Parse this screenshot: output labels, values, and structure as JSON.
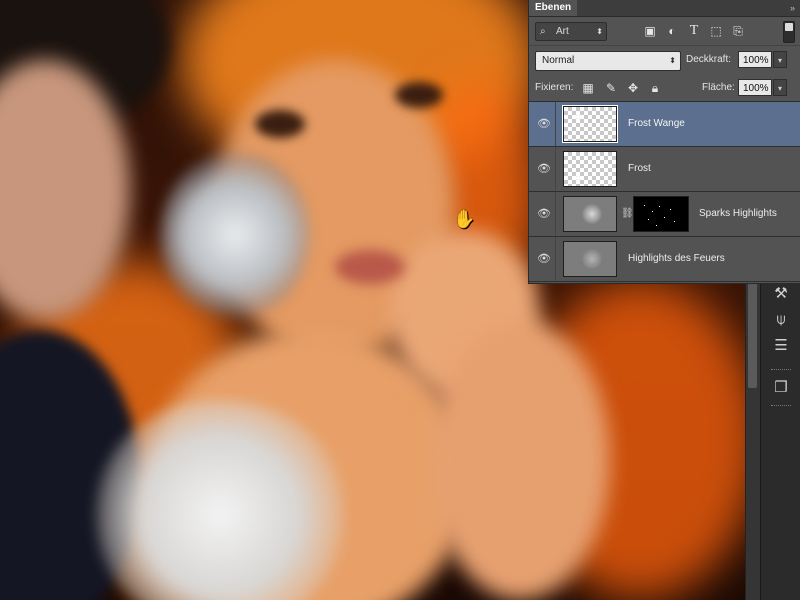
{
  "panel": {
    "tab_label": "Ebenen",
    "collapse_icon": "double-chevron-icon",
    "filter": {
      "icon": "search-icon",
      "value": "Art",
      "options_visible": [
        "Art"
      ]
    },
    "filter_icons": [
      "image-filter-icon",
      "adjustment-filter-icon",
      "type-filter-icon",
      "shape-filter-icon",
      "smart-object-filter-icon"
    ],
    "blend_mode": "Normal",
    "opacity_label": "Deckkraft:",
    "opacity_value": "100%",
    "lock_label": "Fixieren:",
    "lock_icons": [
      "lock-transparency-icon",
      "lock-pixels-icon",
      "lock-position-icon",
      "lock-all-icon"
    ],
    "fill_label": "Fläche:",
    "fill_value": "100%"
  },
  "layers": [
    {
      "name": "Frost Wange",
      "selected": true,
      "visible": true,
      "has_mask": false
    },
    {
      "name": "Frost",
      "selected": false,
      "visible": true,
      "has_mask": false
    },
    {
      "name": "Sparks Highlights",
      "selected": false,
      "visible": true,
      "has_mask": true
    },
    {
      "name": "Highlights des Feuers",
      "selected": false,
      "visible": true,
      "has_mask": false
    }
  ],
  "toolstrip": {
    "tools": [
      "brush-preset-icon",
      "clone-source-icon",
      "actions-icon",
      "3d-icon"
    ]
  },
  "canvas": {
    "cursor": "hand-cursor-icon"
  },
  "colors": {
    "panel_bg": "#535353",
    "selected_layer": "#5c6f8e",
    "fire_orange": "#ff7a1a"
  }
}
